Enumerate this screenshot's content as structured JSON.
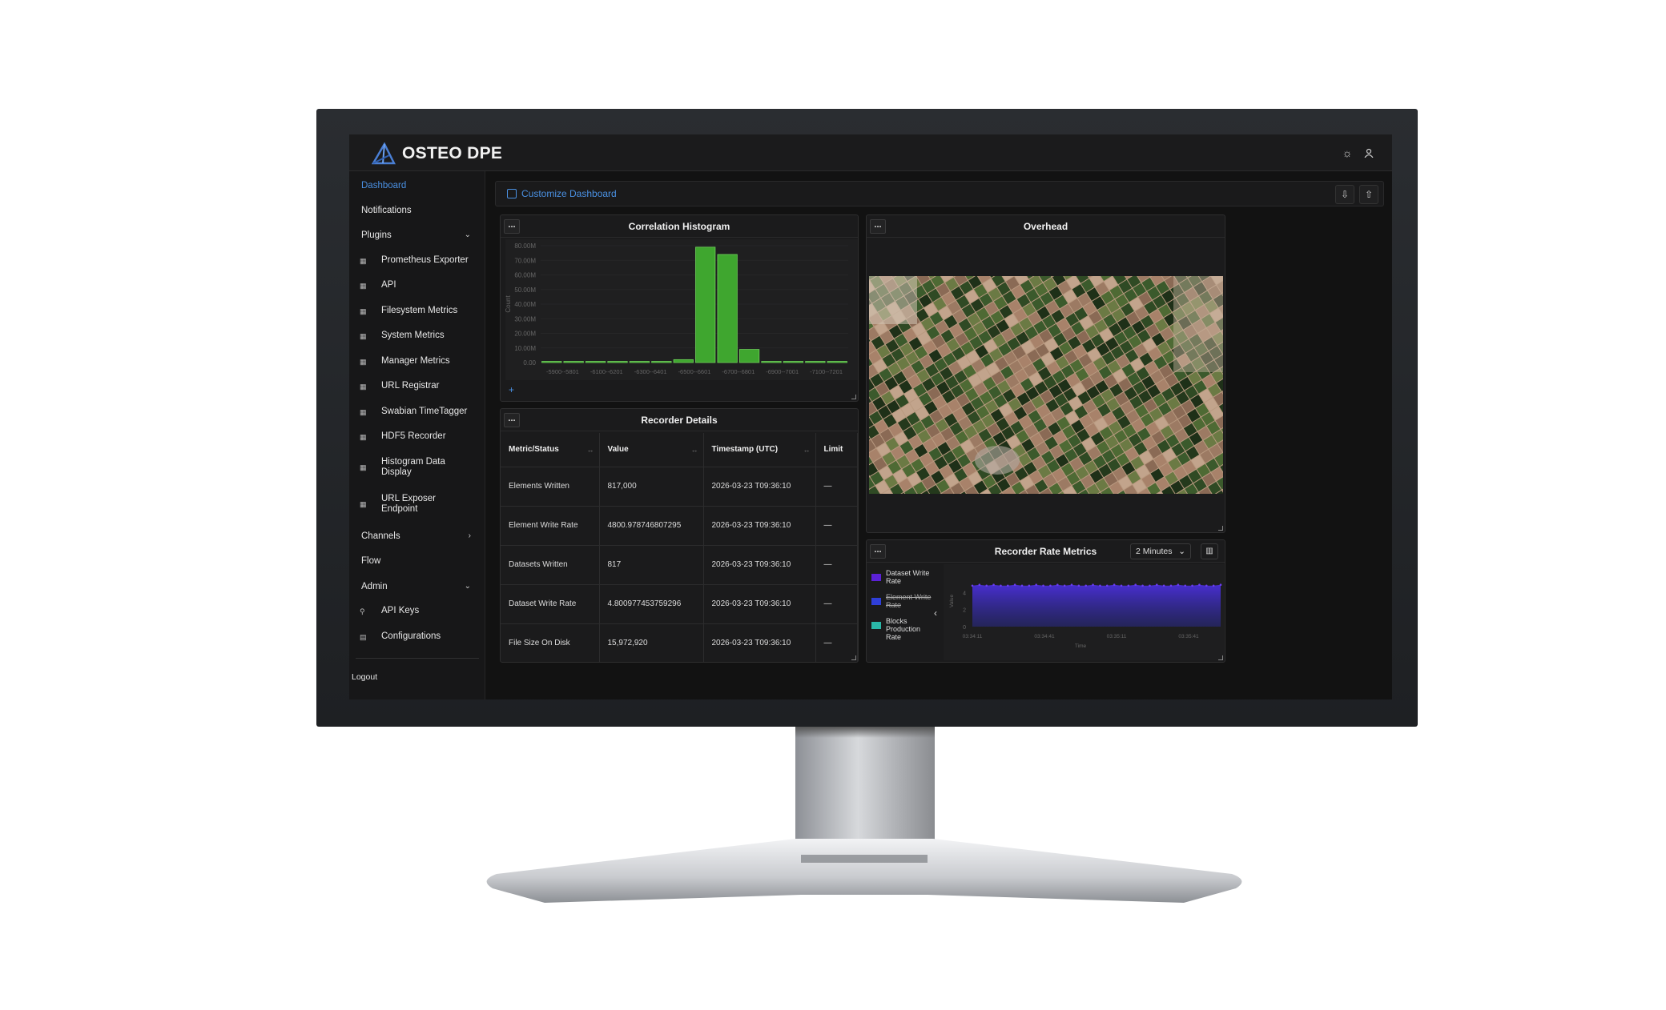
{
  "app": {
    "title": "OSTEO DPE"
  },
  "header": {
    "theme_icon": "sun-icon",
    "user_icon": "user-icon"
  },
  "sidebar": {
    "dashboard": "Dashboard",
    "notifications": "Notifications",
    "plugins": "Plugins",
    "plugin_items": [
      "Prometheus Exporter",
      "API",
      "Filesystem Metrics",
      "System Metrics",
      "Manager Metrics",
      "URL Registrar",
      "Swabian TimeTagger",
      "HDF5 Recorder",
      "Histogram Data Display",
      "URL Exposer Endpoint"
    ],
    "channels": "Channels",
    "flow": "Flow",
    "admin": "Admin",
    "api_keys": "API Keys",
    "configurations": "Configurations",
    "logout": "Logout"
  },
  "toolbar": {
    "customize_label": "Customize Dashboard"
  },
  "panels": {
    "histogram": {
      "title": "Correlation Histogram",
      "menu": "..."
    },
    "details": {
      "title": "Recorder Details",
      "menu": "...",
      "columns": [
        "Metric/Status",
        "Value",
        "Timestamp (UTC)",
        "Limit"
      ],
      "rows": [
        [
          "Elements Written",
          "817,000",
          "2026-03-23 T09:36:10",
          "—"
        ],
        [
          "Element Write Rate",
          "4800.978746807295",
          "2026-03-23 T09:36:10",
          "—"
        ],
        [
          "Datasets Written",
          "817",
          "2026-03-23 T09:36:10",
          "—"
        ],
        [
          "Dataset Write Rate",
          "4.800977453759296",
          "2026-03-23 T09:36:10",
          "—"
        ],
        [
          "File Size On Disk",
          "15,972,920",
          "2026-03-23 T09:36:10",
          "—"
        ]
      ]
    },
    "overhead": {
      "title": "Overhead",
      "menu": "..."
    },
    "rate": {
      "title": "Recorder Rate Metrics",
      "menu": "...",
      "range": "2 Minutes",
      "legend": [
        {
          "name": "Dataset Write Rate",
          "color": "#5b21d6",
          "enabled": true
        },
        {
          "name": "Element Write Rate",
          "color": "#2f3fd8",
          "enabled": false
        },
        {
          "name": "Blocks Production Rate",
          "color": "#2ab8a8",
          "enabled": true
        }
      ]
    }
  },
  "chart_data": [
    {
      "type": "bar",
      "title": "Correlation Histogram",
      "xlabel": "",
      "ylabel": "Count",
      "ylim": [
        0,
        80000000
      ],
      "yticks": [
        "0.00",
        "10.00M",
        "20.00M",
        "30.00M",
        "40.00M",
        "50.00M",
        "60.00M",
        "70.00M",
        "80.00M"
      ],
      "xticks": [
        "-5900--5801",
        "-6100--6201",
        "-6300--6401",
        "-6500--6601",
        "-6700--6801",
        "-6900--7001",
        "-7100--7201"
      ],
      "values": [
        200000,
        200000,
        200000,
        200000,
        200000,
        200000,
        2000000,
        79000000,
        74000000,
        9000000,
        200000,
        200000,
        200000,
        200000
      ],
      "color": "#3fa62f"
    },
    {
      "type": "area",
      "title": "Recorder Rate Metrics",
      "xlabel": "Time",
      "ylabel": "Value",
      "ylim": [
        0,
        6
      ],
      "yticks": [
        "0",
        "2",
        "4"
      ],
      "xticks": [
        "03:34:11",
        "03:34:41",
        "03:35:11",
        "03:35:41"
      ],
      "series": [
        {
          "name": "Dataset Write Rate",
          "values": [
            4.8,
            4.9,
            4.8,
            4.9,
            4.8,
            4.8,
            4.9,
            4.8,
            4.8,
            4.9,
            4.8,
            4.8,
            4.9,
            4.8,
            4.9,
            4.8,
            4.8,
            4.9,
            4.8,
            4.8,
            4.9,
            4.8,
            4.8,
            4.9,
            4.8,
            4.8,
            4.9,
            4.8,
            4.8,
            4.9,
            4.8,
            4.8,
            4.9,
            4.8,
            4.8,
            4.9
          ]
        }
      ]
    }
  ]
}
